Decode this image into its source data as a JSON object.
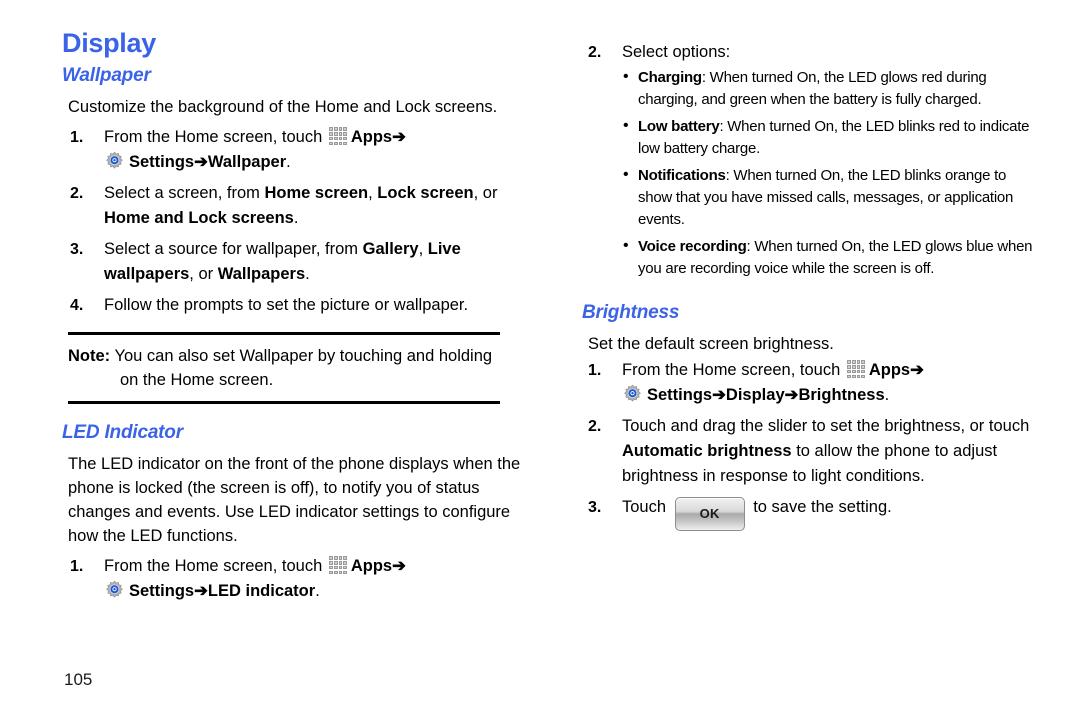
{
  "page": {
    "number": "105",
    "accent_color": "#3B63E8",
    "text_color": "#000000",
    "background": "#FFFFFF"
  },
  "icons": {
    "apps": "apps-grid-icon",
    "settings": "settings-gear-icon",
    "ok_button": "OK",
    "arrow": "➔"
  },
  "left_column": {
    "title": "Display",
    "wallpaper": {
      "heading": "Wallpaper",
      "intro": "Customize the background of the Home and Lock screens.",
      "steps": [
        {
          "num": "1.",
          "parts": [
            {
              "type": "text",
              "value": "From the Home screen, touch "
            },
            {
              "type": "icon",
              "value": "apps-icon"
            },
            {
              "type": "bold",
              "value": "Apps"
            },
            {
              "type": "arrow",
              "value": "➔"
            },
            {
              "type": "break"
            },
            {
              "type": "icon",
              "value": "gear-icon"
            },
            {
              "type": "bold",
              "value": "Settings"
            },
            {
              "type": "arrow",
              "value": "➔"
            },
            {
              "type": "bold",
              "value": "Wallpaper"
            },
            {
              "type": "text",
              "value": "."
            }
          ],
          "line1_pre": "From the Home screen, touch ",
          "line1_apps": "Apps",
          "line2_settings": "Settings",
          "line2_target": "Wallpaper",
          "line2_period": "."
        },
        {
          "num": "2.",
          "pre": "Select a screen, from ",
          "opt1": "Home screen",
          "sep1": ", ",
          "opt2": "Lock screen",
          "sep2": ", or ",
          "opt3": "Home and Lock screens",
          "post": "."
        },
        {
          "num": "3.",
          "pre": "Select a source for wallpaper, from ",
          "opt1": "Gallery",
          "sep1": ", ",
          "opt2": "Live wallpapers",
          "sep2": ", or ",
          "opt3": "Wallpapers",
          "post": "."
        },
        {
          "num": "4.",
          "pre": "Follow the prompts to set the picture or wallpaper."
        }
      ],
      "note": {
        "label": "Note:",
        "text": " You can also set Wallpaper by touching and holding on the Home screen."
      }
    },
    "led_indicator": {
      "heading": "LED Indicator",
      "intro": "The LED indicator on the front of the phone displays when the phone is locked (the screen is off), to notify you of status changes and events. Use LED indicator settings to configure how the LED functions.",
      "step": {
        "num": "1.",
        "line1_pre": "From the Home screen, touch ",
        "line1_apps": "Apps",
        "line2_settings": "Settings",
        "line2_target": "LED indicator",
        "line2_period": "."
      }
    }
  },
  "right_column": {
    "led_options": {
      "num": "2.",
      "lead": "Select options:",
      "bullets": [
        {
          "term": "Charging",
          "desc": ": When turned On, the LED glows red during charging, and green when the battery is fully charged."
        },
        {
          "term": "Low battery",
          "desc": ": When turned On, the LED blinks red to indicate low battery charge."
        },
        {
          "term": "Notifications",
          "desc": ": When turned On, the LED blinks orange to show that you have missed calls, messages, or application events."
        },
        {
          "term": "Voice recording",
          "desc": ": When turned On, the LED glows blue when you are recording voice while the screen is off."
        }
      ]
    },
    "brightness": {
      "heading": "Brightness",
      "intro": "Set the default screen brightness.",
      "steps": [
        {
          "num": "1.",
          "line1_pre": "From the Home screen, touch ",
          "line1_apps": "Apps",
          "line2_settings": "Settings",
          "line2_mid": "Display",
          "line2_target": "Brightness",
          "line2_period": "."
        },
        {
          "num": "2.",
          "pre": "Touch and drag the slider to set the brightness, or touch ",
          "bold": "Automatic brightness",
          "post": " to allow the phone to adjust brightness in response to light conditions."
        },
        {
          "num": "3.",
          "pre": "Touch ",
          "button": "OK",
          "post": " to save the setting."
        }
      ]
    }
  }
}
